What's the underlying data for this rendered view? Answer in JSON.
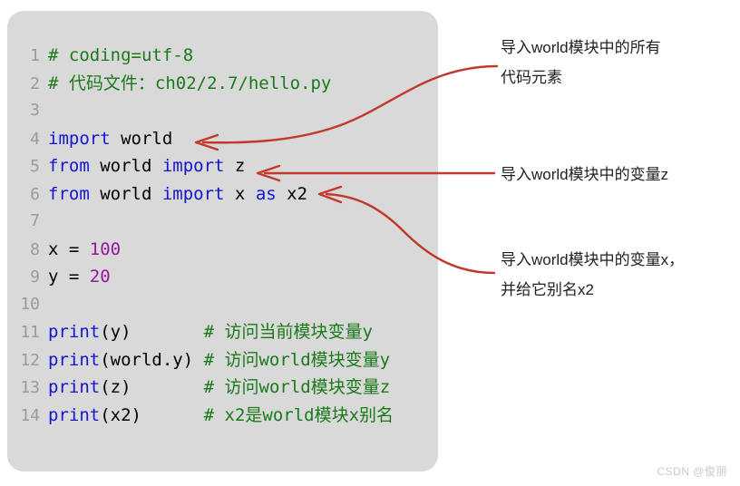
{
  "panel": {
    "background_color": "#d9d9d9",
    "corner_radius_px": 18
  },
  "colors": {
    "comment": "#1a7a1a",
    "keyword": "#1414d2",
    "number": "#93189a",
    "plain_text": "#000000",
    "line_number": "#9a9a9a",
    "arrow": "#c0392b",
    "annotation_text": "#222222",
    "watermark": "#c9c9c9"
  },
  "code": {
    "language": "python",
    "lines": [
      {
        "number": "1",
        "tokens": [
          {
            "text": "# coding=utf-8",
            "type": "comment"
          }
        ]
      },
      {
        "number": "2",
        "tokens": [
          {
            "text": "# 代码文件：ch02/2.7/hello.py",
            "type": "comment"
          }
        ]
      },
      {
        "number": "3",
        "tokens": []
      },
      {
        "number": "4",
        "tokens": [
          {
            "text": "import",
            "type": "keyword"
          },
          {
            "text": " world",
            "type": "plain"
          }
        ]
      },
      {
        "number": "5",
        "tokens": [
          {
            "text": "from",
            "type": "keyword"
          },
          {
            "text": " world ",
            "type": "plain"
          },
          {
            "text": "import",
            "type": "keyword"
          },
          {
            "text": " z",
            "type": "plain"
          }
        ]
      },
      {
        "number": "6",
        "tokens": [
          {
            "text": "from",
            "type": "keyword"
          },
          {
            "text": " world ",
            "type": "plain"
          },
          {
            "text": "import",
            "type": "keyword"
          },
          {
            "text": " x ",
            "type": "plain"
          },
          {
            "text": "as",
            "type": "keyword"
          },
          {
            "text": " x2",
            "type": "plain"
          }
        ]
      },
      {
        "number": "7",
        "tokens": []
      },
      {
        "number": "8",
        "tokens": [
          {
            "text": "x = ",
            "type": "plain"
          },
          {
            "text": "100",
            "type": "number"
          }
        ]
      },
      {
        "number": "9",
        "tokens": [
          {
            "text": "y = ",
            "type": "plain"
          },
          {
            "text": "20",
            "type": "number"
          }
        ]
      },
      {
        "number": "10",
        "tokens": []
      },
      {
        "number": "11",
        "tokens": [
          {
            "text": "print",
            "type": "func"
          },
          {
            "text": "(y)",
            "type": "plain"
          },
          {
            "text": "# 访问当前模块变量y",
            "type": "comment",
            "column": 15
          }
        ]
      },
      {
        "number": "12",
        "tokens": [
          {
            "text": "print",
            "type": "func"
          },
          {
            "text": "(world.y)",
            "type": "plain"
          },
          {
            "text": "# 访问world模块变量y",
            "type": "comment",
            "column": 15
          }
        ]
      },
      {
        "number": "13",
        "tokens": [
          {
            "text": "print",
            "type": "func"
          },
          {
            "text": "(z)",
            "type": "plain"
          },
          {
            "text": "# 访问world模块变量z",
            "type": "comment",
            "column": 15
          }
        ]
      },
      {
        "number": "14",
        "tokens": [
          {
            "text": "print",
            "type": "func"
          },
          {
            "text": "(x2)",
            "type": "plain"
          },
          {
            "text": "# x2是world模块x别名",
            "type": "comment",
            "column": 15
          }
        ]
      }
    ]
  },
  "annotations": [
    {
      "id": "annotation-1",
      "text": "导入world模块中的所有\n代码元素",
      "target_line": "4",
      "arrow": "s-curve-down-left"
    },
    {
      "id": "annotation-2",
      "text": "导入world模块中的变量z",
      "target_line": "5",
      "arrow": "straight-left"
    },
    {
      "id": "annotation-3",
      "text": "导入world模块中的变量x，\n并给它别名x2",
      "target_line": "6",
      "arrow": "s-curve-up-left"
    }
  ],
  "watermark": {
    "text": "CSDN @俊丽"
  }
}
